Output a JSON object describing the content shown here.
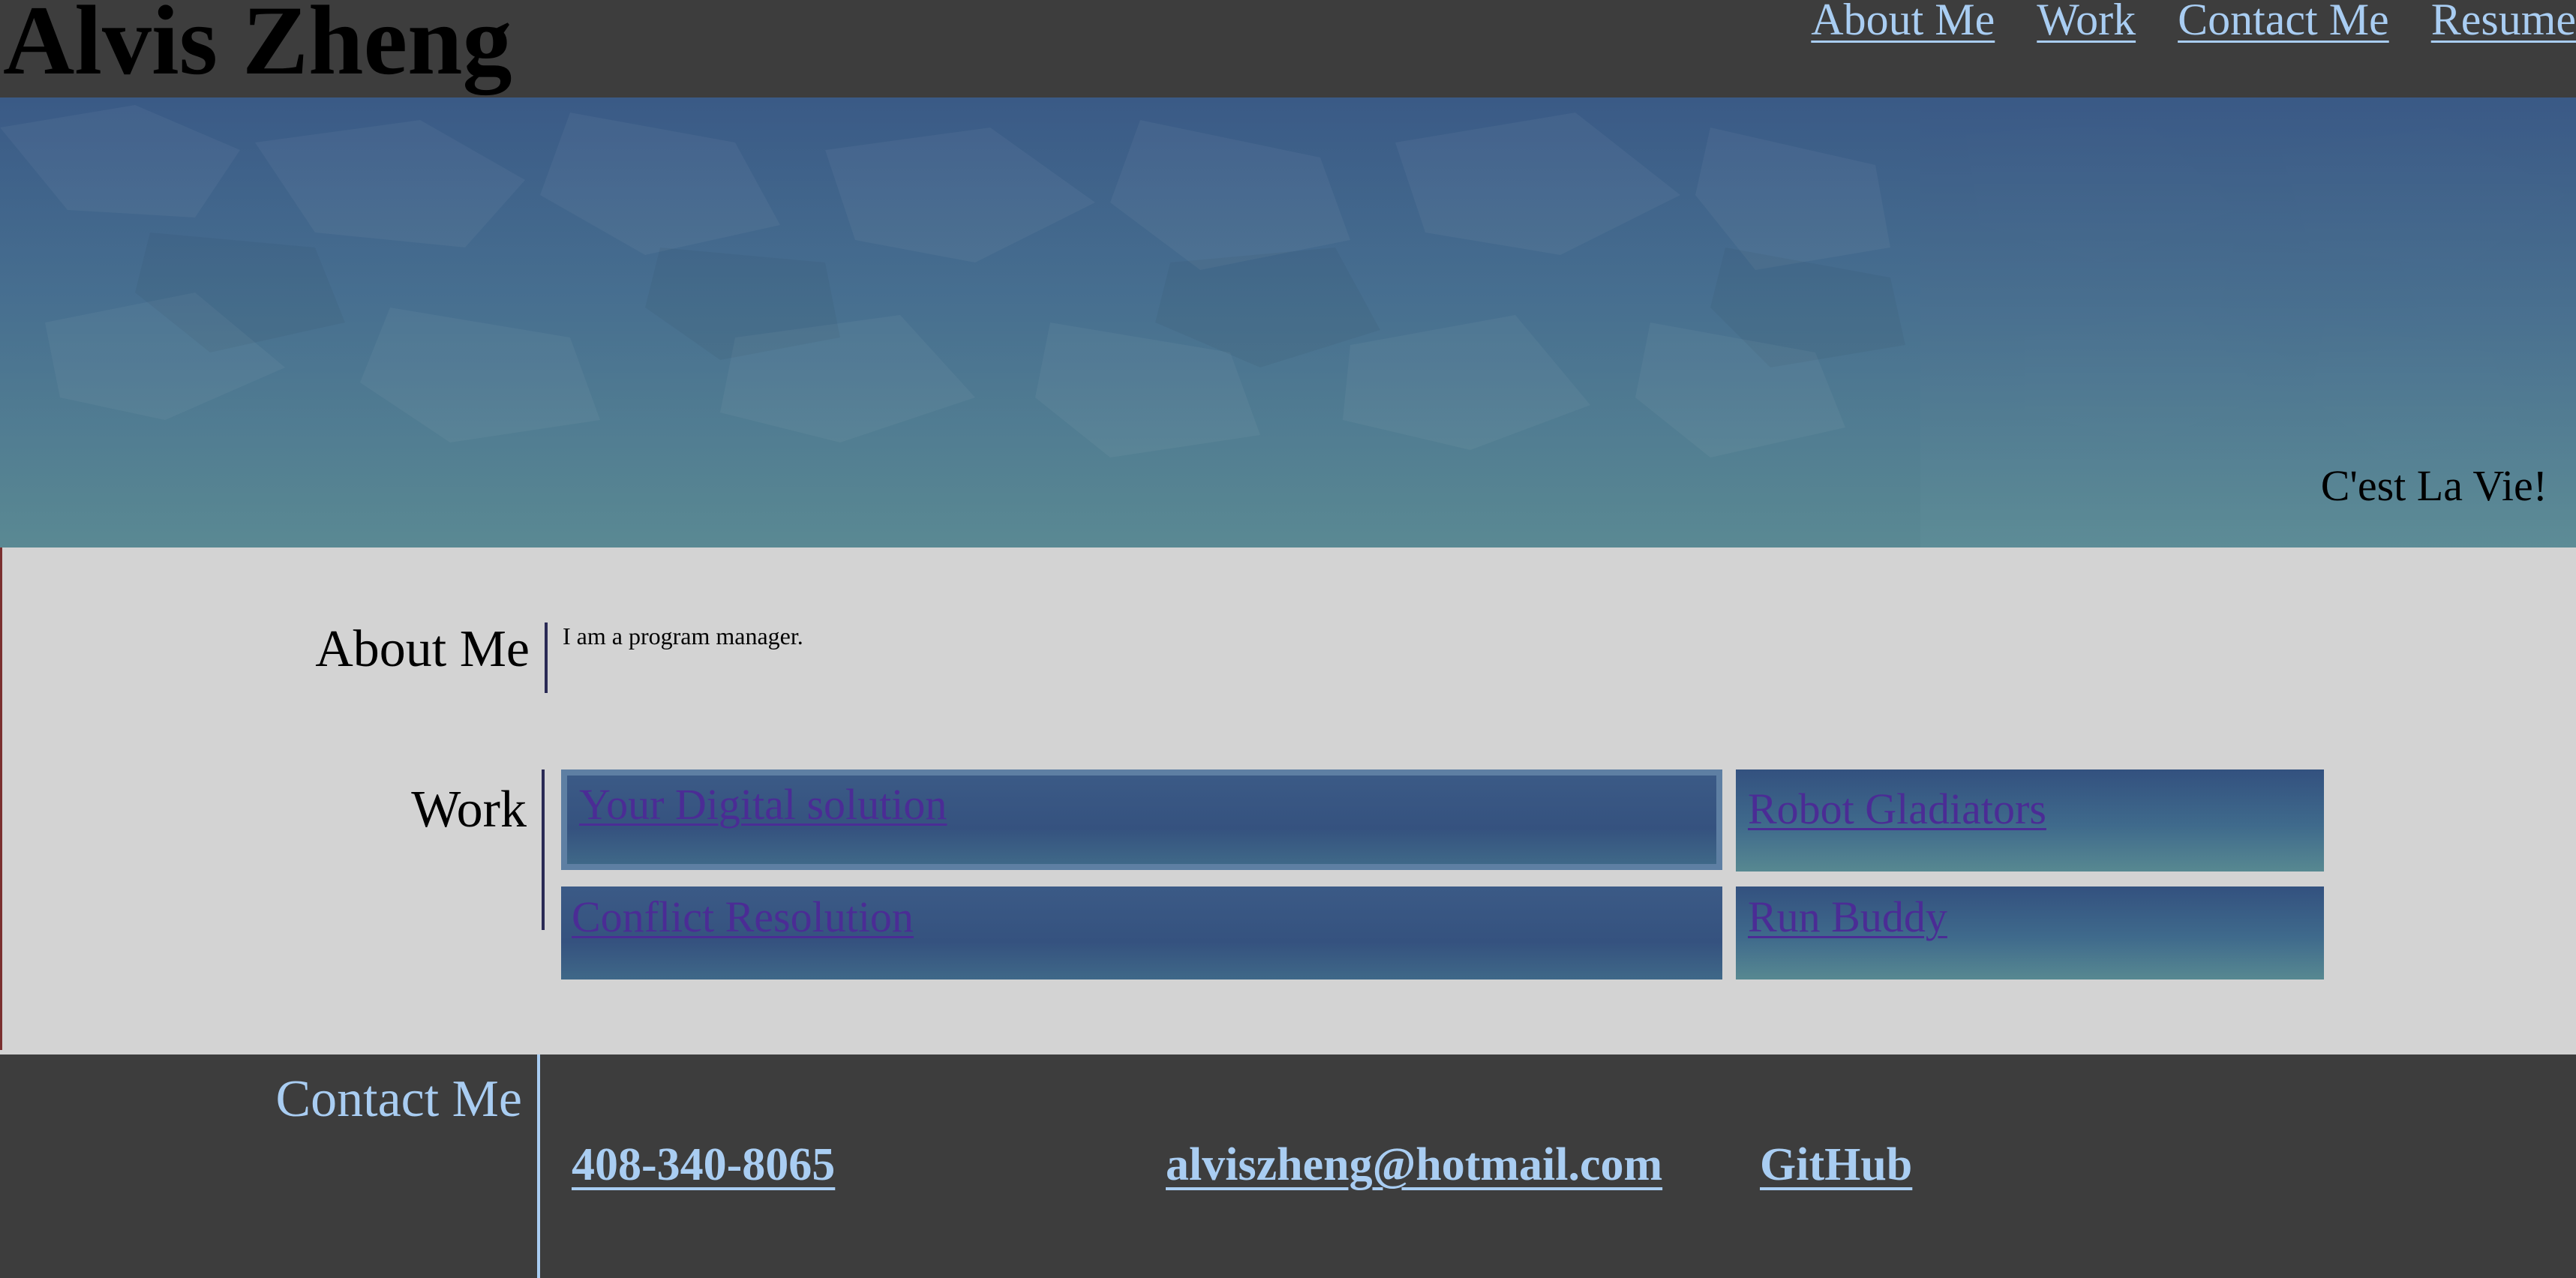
{
  "header": {
    "brand": "Alvis Zheng",
    "nav": [
      "About Me",
      "Work",
      "Contact Me",
      "Resume"
    ]
  },
  "hero": {
    "tagline": "C'est La Vie!"
  },
  "about": {
    "label": "About Me",
    "text": "I am a program manager."
  },
  "work": {
    "label": "Work",
    "items": [
      "Your Digital solution",
      "Robot Gladiators",
      "Conflict Resolution",
      "Run Buddy"
    ]
  },
  "contact": {
    "label": "Contact Me",
    "phone": "408-340-8065",
    "email": "alviszheng@hotmail.com",
    "github": "GitHub"
  },
  "colors": {
    "header_bg": "#3d3d3d",
    "link_light": "#a9cdf2",
    "card_link": "#4b2c95",
    "main_bg": "#d3d3d3"
  }
}
